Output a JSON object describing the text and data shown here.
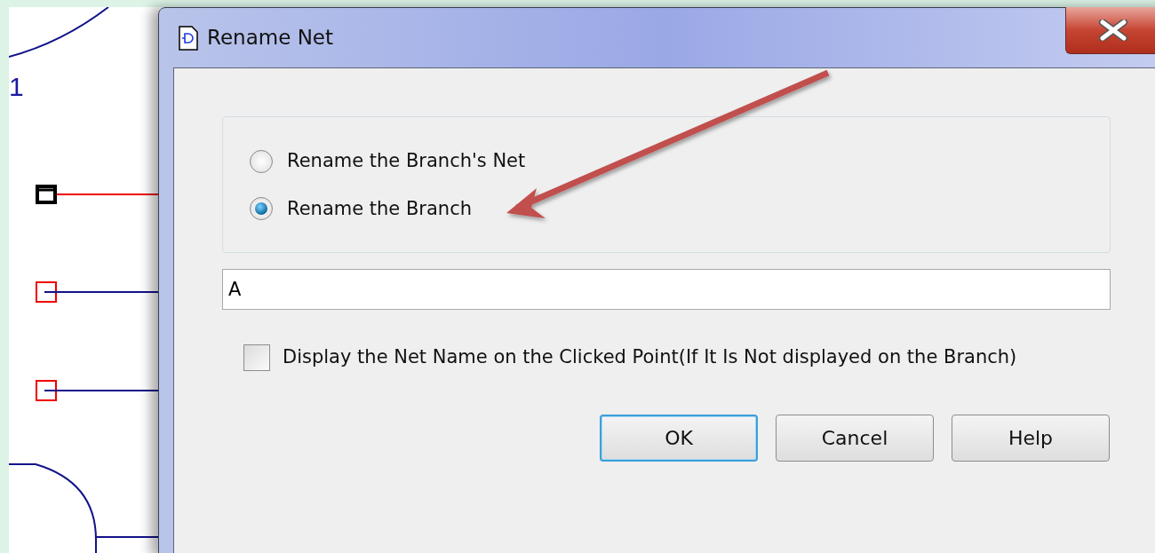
{
  "schematic": {
    "pin_label": "1"
  },
  "window": {
    "title": "Rename Net"
  },
  "rename_options": [
    {
      "label": "Rename the Branch's Net",
      "selected": false
    },
    {
      "label": "Rename the Branch",
      "selected": true
    }
  ],
  "name_field": {
    "value": "A"
  },
  "display_option": {
    "label": "Display the Net Name on the Clicked Point(If It Is Not displayed on the Branch)",
    "checked": false
  },
  "buttons": [
    {
      "label": "OK",
      "default": true
    },
    {
      "label": "Cancel",
      "default": false
    },
    {
      "label": "Help",
      "default": false
    }
  ]
}
